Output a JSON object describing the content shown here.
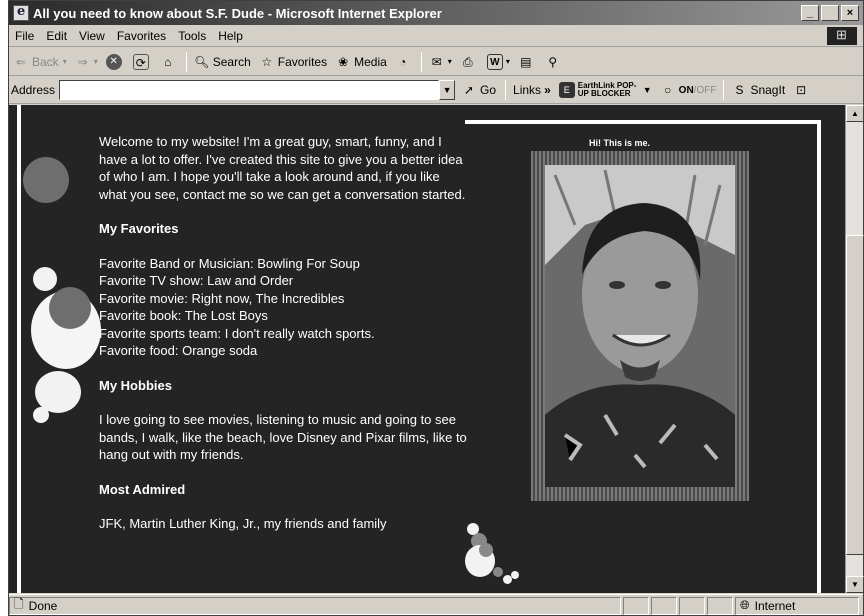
{
  "window": {
    "title": "All you need to know about S.F. Dude - Microsoft Internet Explorer",
    "btn_min": "_",
    "btn_max": " ",
    "btn_close": "×"
  },
  "menu": [
    "File",
    "Edit",
    "View",
    "Favorites",
    "Tools",
    "Help"
  ],
  "toolbar": {
    "back": "Back",
    "search": "Search",
    "favorites": "Favorites",
    "media": "Media"
  },
  "address": {
    "label": "Address",
    "value": "",
    "go": "Go",
    "links": "Links",
    "earthlink": "EarthLink POP-UP BLOCKER",
    "on": "ON",
    "off": "/OFF",
    "snagit": "SnagIt"
  },
  "page": {
    "intro": "Welcome to my website! I'm a great guy, smart, funny, and I have a lot to offer. I've created this site to give you a better idea of who I am. I hope you'll take a look around and, if you like what you see, contact me so we can get a conversation started.",
    "favorites_heading": "My Favorites",
    "favorites": [
      "Favorite Band or Musician: Bowling For Soup",
      "Favorite TV show: Law and Order",
      "Favorite movie: Right now, The Incredibles",
      "Favorite book: The Lost Boys",
      "Favorite sports team: I don't really watch sports.",
      "Favorite food: Orange soda"
    ],
    "hobbies_heading": "My Hobbies",
    "hobbies": "I love going to see movies, listening to music and going to see bands, I walk, like the beach, love Disney and Pixar films, like to hang out with my friends.",
    "admired_heading": "Most Admired",
    "admired": "JFK, Martin Luther King, Jr., my friends and family",
    "photo_caption": "Hi! This is me."
  },
  "status": {
    "text": "Done",
    "zone": "Internet"
  }
}
